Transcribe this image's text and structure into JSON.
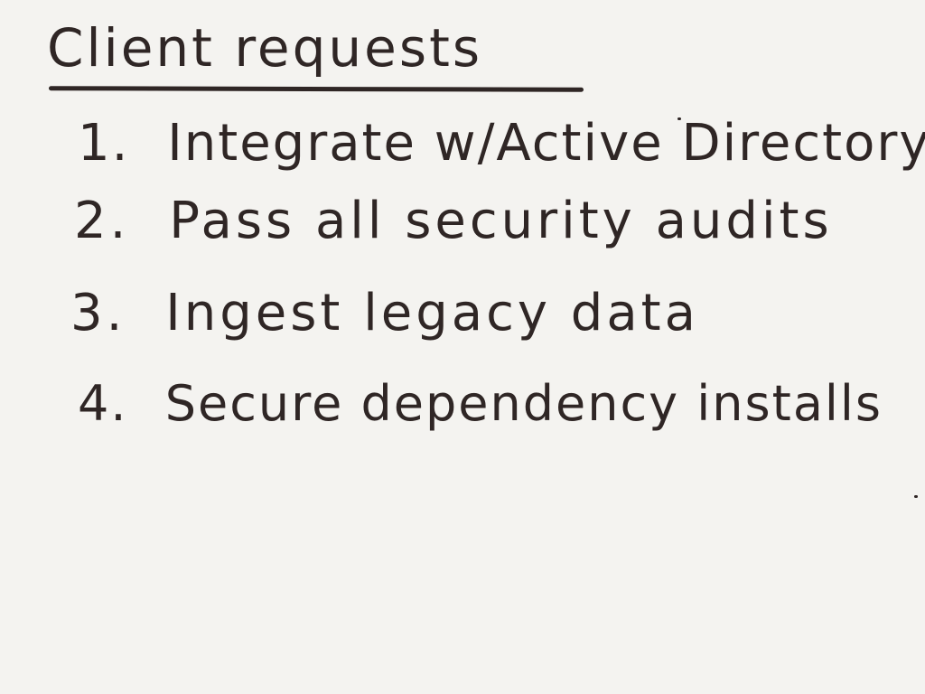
{
  "note": {
    "title": "Client requests",
    "items": [
      {
        "number": "1.",
        "text": "Integrate w/Active Directory"
      },
      {
        "number": "2.",
        "text": "Pass all security audits"
      },
      {
        "number": "3.",
        "text": "Ingest legacy data"
      },
      {
        "number": "4.",
        "text": "Secure dependency installs"
      }
    ]
  },
  "colors": {
    "paper": "#f4f3f0",
    "ink": "#2f2625"
  }
}
